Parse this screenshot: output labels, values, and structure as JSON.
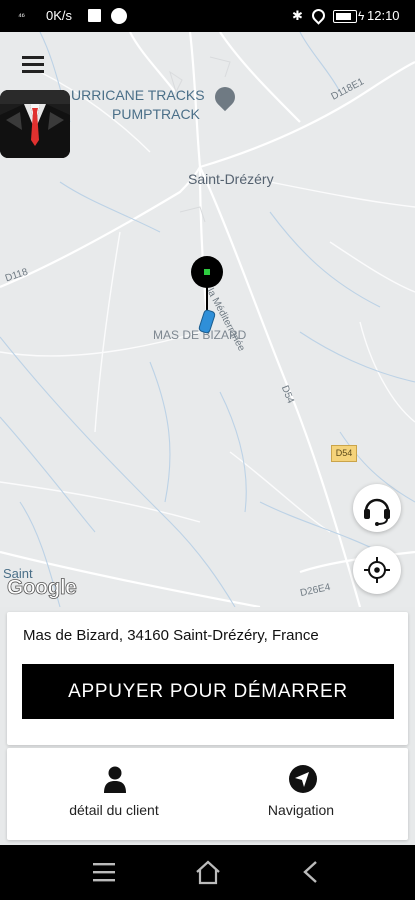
{
  "status_bar": {
    "signal": "⁴⁶",
    "speed": "0K/s",
    "time": "12:10",
    "icons": [
      "signal-icon",
      "image-icon",
      "circle-icon",
      "bluetooth-icon",
      "location-icon",
      "battery-icon"
    ]
  },
  "map": {
    "labels": {
      "place_1": "URRICANE TRACKS",
      "place_2": "PUMPTRACK",
      "village": "Saint-Drézéry",
      "road_d118": "D118",
      "road_d118e1": "D118E1",
      "avenue": "Av. de la Méditerranée",
      "mas": "MAS DE BIZARD",
      "road_d54": "D54",
      "badge_d54": "D54",
      "road_d26e4": "D26E4",
      "saint": "Saint"
    },
    "attribution": "Google"
  },
  "address": "Mas de Bizard, 34160 Saint-Drézéry, France",
  "start_button": "APPUYER POUR DÉMARRER",
  "actions": {
    "client": "détail du client",
    "navigation": "Navigation"
  },
  "colors": {
    "accent": "#000000",
    "marker_dot": "#2ecc40",
    "car": "#2f8fd8",
    "tie": "#e0312f",
    "map_bg": "#e8eaeb"
  }
}
